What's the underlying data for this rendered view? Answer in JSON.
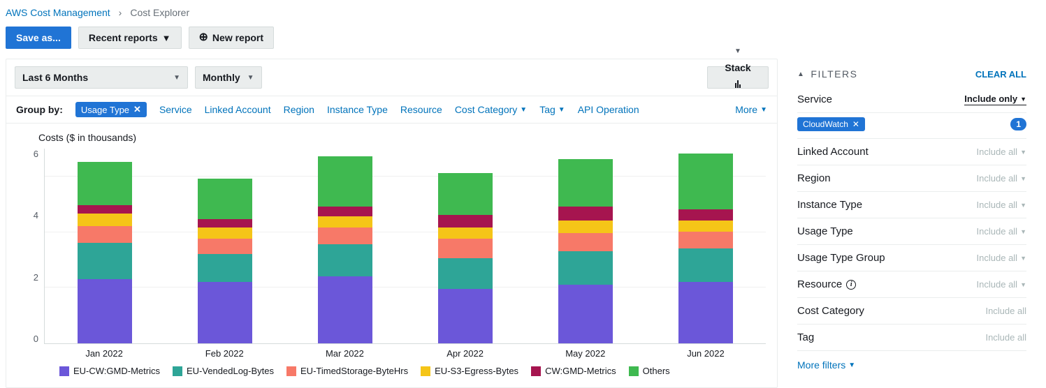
{
  "breadcrumb": {
    "root": "AWS Cost Management",
    "current": "Cost Explorer"
  },
  "toolbar": {
    "save": "Save as...",
    "recent": "Recent reports",
    "new": "New report"
  },
  "controls": {
    "range": "Last 6 Months",
    "granularity": "Monthly",
    "chart_mode": "Stack"
  },
  "groupby": {
    "label": "Group by:",
    "active": "Usage Type",
    "options": [
      "Service",
      "Linked Account",
      "Region",
      "Instance Type",
      "Resource",
      "Cost Category",
      "Tag",
      "API Operation"
    ],
    "has_caret": {
      "Cost Category": true,
      "Tag": true
    },
    "more": "More"
  },
  "chart_data": {
    "type": "bar",
    "title": "Costs ($ in thousands)",
    "ylabel": "",
    "ylim": [
      0,
      7
    ],
    "yticks": [
      0,
      2,
      4,
      6
    ],
    "categories": [
      "Jan 2022",
      "Feb 2022",
      "Mar 2022",
      "Apr 2022",
      "May 2022",
      "Jun 2022"
    ],
    "series": [
      {
        "name": "EU-CW:GMD-Metrics",
        "color": "#6b57d9",
        "values": [
          2.3,
          2.2,
          2.4,
          1.95,
          2.1,
          2.2
        ]
      },
      {
        "name": "EU-VendedLog-Bytes",
        "color": "#2ea597",
        "values": [
          1.3,
          1.0,
          1.15,
          1.1,
          1.2,
          1.2
        ]
      },
      {
        "name": "EU-TimedStorage-ByteHrs",
        "color": "#f77968",
        "values": [
          0.6,
          0.55,
          0.6,
          0.7,
          0.65,
          0.6
        ]
      },
      {
        "name": "EU-S3-Egress-Bytes",
        "color": "#f5c518",
        "values": [
          0.45,
          0.4,
          0.4,
          0.4,
          0.45,
          0.4
        ]
      },
      {
        "name": "CW:GMD-Metrics",
        "color": "#a6154f",
        "values": [
          0.3,
          0.3,
          0.35,
          0.45,
          0.5,
          0.4
        ]
      },
      {
        "name": "Others",
        "color": "#3fb950",
        "values": [
          1.55,
          1.45,
          1.8,
          1.5,
          1.7,
          2.0
        ]
      }
    ]
  },
  "filters": {
    "title": "FILTERS",
    "clear": "CLEAR ALL",
    "rows": [
      {
        "name": "Service",
        "mode": "Include only",
        "active": true,
        "tag": "CloudWatch",
        "count": 1
      },
      {
        "name": "Linked Account",
        "mode": "Include all"
      },
      {
        "name": "Region",
        "mode": "Include all"
      },
      {
        "name": "Instance Type",
        "mode": "Include all"
      },
      {
        "name": "Usage Type",
        "mode": "Include all"
      },
      {
        "name": "Usage Type Group",
        "mode": "Include all"
      },
      {
        "name": "Resource",
        "mode": "Include all",
        "info": true
      },
      {
        "name": "Cost Category",
        "mode": "Include all",
        "no_caret": true
      },
      {
        "name": "Tag",
        "mode": "Include all",
        "no_caret": true
      }
    ],
    "more": "More filters"
  }
}
